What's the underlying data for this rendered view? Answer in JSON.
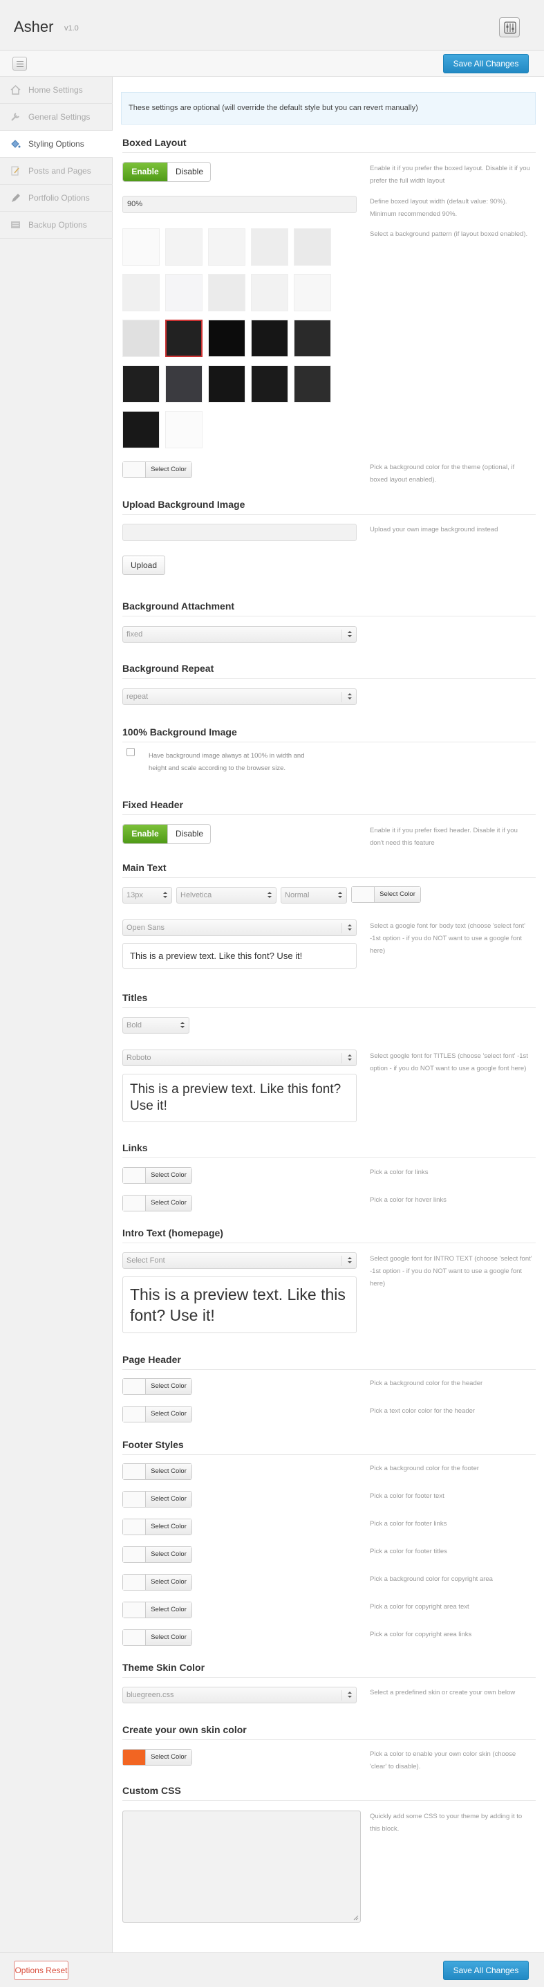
{
  "app": {
    "title": "Asher",
    "version": "v1.0"
  },
  "toolbar": {
    "save_label": "Save All Changes"
  },
  "sidebar": {
    "items": [
      {
        "label": "Home Settings",
        "icon": "home-icon"
      },
      {
        "label": "General Settings",
        "icon": "wrench-icon"
      },
      {
        "label": "Styling Options",
        "icon": "paint-bucket-icon"
      },
      {
        "label": "Posts and Pages",
        "icon": "edit-page-icon"
      },
      {
        "label": "Portfolio Options",
        "icon": "pencil-icon"
      },
      {
        "label": "Backup Options",
        "icon": "backup-icon"
      }
    ],
    "active": "Styling Options"
  },
  "info": "These settings are optional (will override the default style but you can revert manually)",
  "toggle": {
    "enable": "Enable",
    "disable": "Disable"
  },
  "color_button": {
    "label": "Select Color"
  },
  "boxed": {
    "title": "Boxed Layout",
    "help": "Enable it if you prefer the boxed layout. Disable it if you prefer the full width layout",
    "width_value": "90%",
    "width_help": "Define boxed layout width (default value: 90%). Minimum recommended 90%.",
    "pattern_help": "Select a background pattern (if layout boxed enabled).",
    "color_help": "Pick a background color for the theme (optional, if boxed layout enabled)."
  },
  "upload_bg": {
    "title": "Upload Background Image",
    "help": "Upload your own image background instead",
    "button": "Upload"
  },
  "bg_attachment": {
    "title": "Background Attachment",
    "value": "fixed"
  },
  "bg_repeat": {
    "title": "Background Repeat",
    "value": "repeat"
  },
  "bg_100": {
    "title": "100% Background Image",
    "label": "Have background image always at 100% in width and height and scale according to the browser size."
  },
  "fixed_header": {
    "title": "Fixed Header",
    "help": "Enable it if you prefer fixed header. Disable it if you don't need this feature"
  },
  "main_text": {
    "title": "Main Text",
    "size": "13px",
    "family": "Helvetica",
    "weight": "Normal",
    "google_font": "Open Sans",
    "help": "Select a google font for body text (choose 'select font' -1st option - if you do NOT want to use a google font here)",
    "preview": "This is a preview text. Like this font? Use it!"
  },
  "titles": {
    "title": "Titles",
    "weight": "Bold",
    "google_font": "Roboto",
    "help": "Select google font for TITLES (choose 'select font' -1st option - if you do NOT want to use a google font here)",
    "preview": "This is a preview text. Like this font? Use it!"
  },
  "links": {
    "title": "Links",
    "help1": "Pick a color for links",
    "help2": "Pick a color for hover links"
  },
  "intro": {
    "title": "Intro Text (homepage)",
    "google_font": "Select Font",
    "help": "Select google font for INTRO TEXT (choose 'select font' -1st option - if you do NOT want to use a google font here)",
    "preview": "This is a preview text. Like this font? Use it!"
  },
  "page_header": {
    "title": "Page Header",
    "help1": "Pick a background color for the header",
    "help2": "Pick a text color color for the header"
  },
  "footer_styles": {
    "title": "Footer Styles",
    "helps": [
      "Pick a background color for the footer",
      "Pick a color for footer text",
      "Pick a color for footer links",
      "Pick a color for footer titles",
      "Pick a background color for copyright area",
      "Pick a color for copyright area text",
      "Pick a color for copyright area links"
    ]
  },
  "skin": {
    "title": "Theme Skin Color",
    "value": "bluegreen.css",
    "help": "Select a predefined skin or create your own below"
  },
  "own_skin": {
    "title": "Create your own skin color",
    "swatch": "#f26522",
    "help": "Pick a color to enable your own color skin (choose 'clear' to disable)."
  },
  "custom_css": {
    "title": "Custom CSS",
    "help": "Quickly add some CSS to your theme by adding it to this block."
  },
  "footer": {
    "reset_label": "Options Reset"
  },
  "colors": {
    "accent": "#2289c4",
    "enable": "#5da323",
    "reset": "#d9503f"
  }
}
